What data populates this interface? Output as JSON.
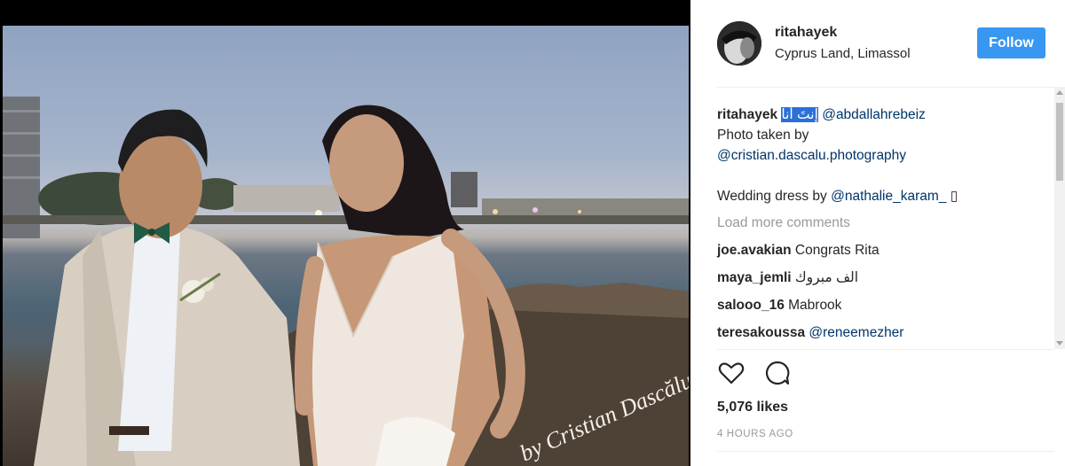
{
  "post": {
    "watermark": "by Cristian Dascălu"
  },
  "header": {
    "username": "ritahayek",
    "location": "Cyprus Land, Limassol",
    "follow_label": "Follow"
  },
  "caption": {
    "username": "ritahayek",
    "arabic_text": "إنتَ أنا",
    "mention_groom": "@abdallahrebeiz",
    "photo_credit_text": "Photo taken by",
    "mention_photographer": "@cristian.dascalu.photography",
    "dress_text": "Wedding dress by",
    "mention_dress": "@nathalie_karam_",
    "trailing_glyph": "▯"
  },
  "comments": {
    "load_more": "Load more comments",
    "items": [
      {
        "user": "joe.avakian",
        "text": "Congrats Rita"
      },
      {
        "user": "maya_jemli",
        "text": "الف مبروك"
      },
      {
        "user": "salooo_16",
        "text": "Mabrook"
      },
      {
        "user": "teresakoussa",
        "text": "@reneemezher"
      }
    ]
  },
  "engagement": {
    "likes": "5,076 likes",
    "time": "4 HOURS AGO"
  },
  "icons": {
    "like": "heart-icon",
    "comment": "comment-bubble-icon"
  },
  "colors": {
    "follow_button": "#3897f0",
    "mention": "#003569",
    "muted": "#999999"
  }
}
